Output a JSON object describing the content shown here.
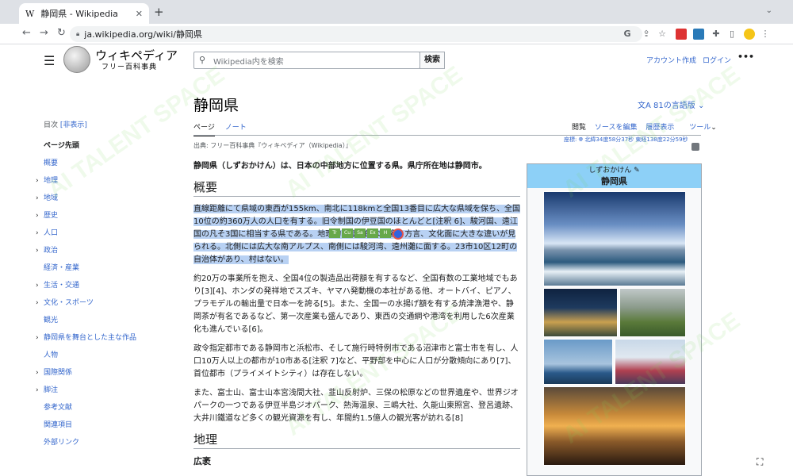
{
  "browser": {
    "tab_title": "静岡県 - Wikipedia",
    "tab_favicon": "W",
    "url": "ja.wikipedia.org/wiki/静岡県"
  },
  "header": {
    "logo_title": "ウィキペディア",
    "logo_subtitle": "フリー百科事典",
    "search_placeholder": "Wikipedia内を検索",
    "search_button": "検索",
    "account_create": "アカウント作成",
    "login": "ログイン",
    "more": "•••"
  },
  "toc": {
    "label": "目次",
    "hide": "[非表示]",
    "items": [
      {
        "label": "ページ先頭",
        "chev": ""
      },
      {
        "label": "概要",
        "chev": ""
      },
      {
        "label": "地理",
        "chev": "›"
      },
      {
        "label": "地域",
        "chev": "›"
      },
      {
        "label": "歴史",
        "chev": "›"
      },
      {
        "label": "人口",
        "chev": "›"
      },
      {
        "label": "政治",
        "chev": "›"
      },
      {
        "label": "経済・産業",
        "chev": ""
      },
      {
        "label": "生活・交通",
        "chev": "›"
      },
      {
        "label": "文化・スポーツ",
        "chev": "›"
      },
      {
        "label": "観光",
        "chev": ""
      },
      {
        "label": "静岡県を舞台とした主な作品",
        "chev": "›"
      },
      {
        "label": "人物",
        "chev": ""
      },
      {
        "label": "国際関係",
        "chev": "›"
      },
      {
        "label": "脚注",
        "chev": "›"
      },
      {
        "label": "参考文献",
        "chev": ""
      },
      {
        "label": "関連項目",
        "chev": ""
      },
      {
        "label": "外部リンク",
        "chev": ""
      }
    ]
  },
  "page": {
    "title": "静岡県",
    "languages": "81の言語版",
    "tab_page": "ページ",
    "tab_note": "ノート",
    "tab_read": "閲覧",
    "tab_edit": "ソースを編集",
    "tab_history": "履歴表示",
    "tab_tools": "ツール",
    "source": "出典: フリー百科事典『ウィキペディア（Wikipedia）』",
    "coords_label": "座標:",
    "coords": "北緯34度58分37秒 東経138度22分59秒",
    "intro": "静岡県（しずおかけん）は、日本の中部地方に位置する県。県庁所在地は静岡市。",
    "h_overview": "概要",
    "p1": "直線距離にて県域の東西が155km、南北に118kmと全国13番目に広大な県域を保ち、全国10位の約360万人の人口を有する。旧令制国の伊豆国のほとんどと[注釈 6]、駿河国、遠江国の凡そ3国に相当する県である。地理的、歴史的な影響、方言、文化面に大きな違いが見られる。北側には広大な南アルプス、南側には駿河湾、遠州灘に面する。23市10区12町の自治体があり、村はない。",
    "p2": "約20万の事業所を抱え、全国4位の製造品出荷額を有するなど、全国有数の工業地域でもあり[3][4]、ホンダの発祥地でスズキ、ヤマハ発動機の本社がある他、オートバイ、ピアノ、プラモデルの輸出量で日本一を誇る[5]。また、全国一の水揚げ額を有する焼津漁港や、静岡茶が有名であるなど、第一次産業も盛んであり、東西の交通網や港湾を利用した6次産業化も進んでいる[6]。",
    "p3": "政令指定都市である静岡市と浜松市、そして施行時特例市である沼津市と富士市を有し、人口10万人以上の都市が10市ある[注釈 7]など、平野部を中心に人口が分散傾向にあり[7]、首位都市（プライメイトシティ）は存在しない。",
    "p4": "また、富士山、富士山本宮浅間大社、韮山反射炉、三保の松原などの世界遺産や、世界ジオパークの一つである伊豆半島ジオパーク、熱海温泉、三嶋大社、久能山東照宮、登呂遺跡、大井川鐵道など多くの観光資源を有し、年間約1.5億人の観光客が訪れる[8]",
    "h_geo": "地理",
    "h3_area": "広袤"
  },
  "infobox": {
    "reading": "しずおかけん",
    "name": "静岡県"
  },
  "popover": [
    "Tr",
    "Cu",
    "Sa",
    "Ex",
    "H"
  ],
  "colors": {
    "link": "#3366cc",
    "infobox_header": "#8dd0f7",
    "highlight": "#b8d1f3"
  },
  "watermark": "AI TALENT SPACE"
}
